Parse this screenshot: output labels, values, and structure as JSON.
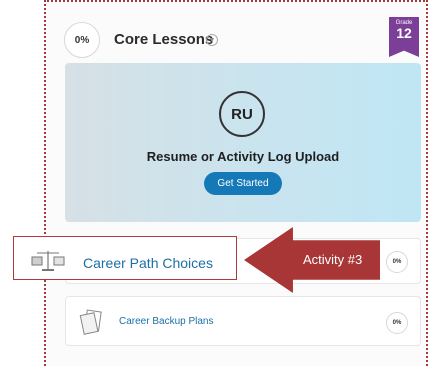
{
  "header": {
    "progress": "0%",
    "title": "Core Lessons",
    "chevron_icon": "chevron-down-icon",
    "grade_label": "Grade",
    "grade_value": "12"
  },
  "featured": {
    "badge_text": "RU",
    "title": "Resume or Activity Log Upload",
    "button_label": "Get Started"
  },
  "activities": [
    {
      "icon": "scales-icon",
      "label": "Career Path Choices",
      "progress": "0%"
    },
    {
      "icon": "documents-icon",
      "label": "Career Backup Plans",
      "progress": "0%"
    }
  ],
  "annotation": {
    "label": "Activity #3",
    "color": "#a83636"
  },
  "colors": {
    "accent": "#1679b7",
    "grade_ribbon": "#7b3f97",
    "link": "#1b6fa5"
  }
}
